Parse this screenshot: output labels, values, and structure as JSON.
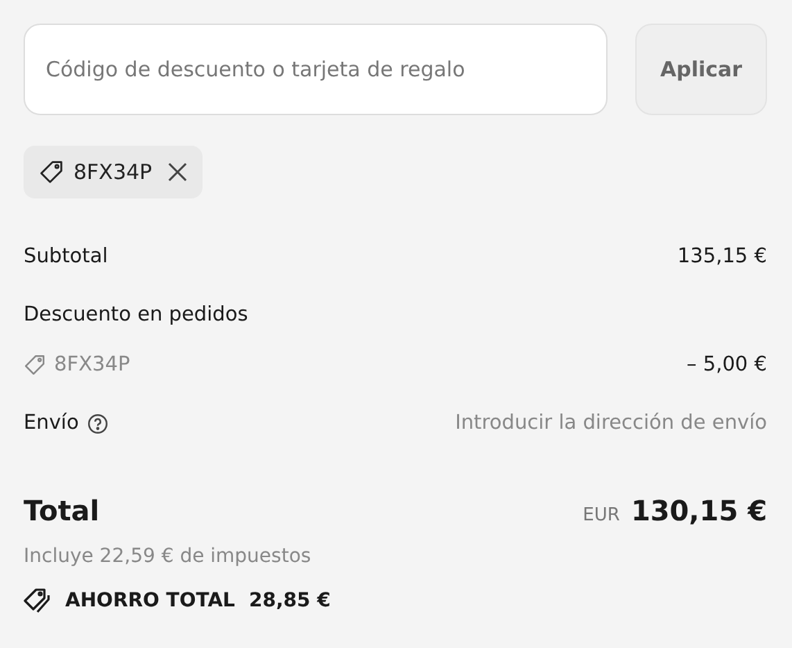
{
  "discount_field": {
    "placeholder": "Código de descuento o tarjeta de regalo"
  },
  "apply_button": {
    "label": "Aplicar"
  },
  "applied_codes": [
    {
      "code": "8FX34P"
    }
  ],
  "subtotal": {
    "label": "Subtotal",
    "value": "135,15 €"
  },
  "order_discount": {
    "label": "Descuento en pedidos",
    "code": "8FX34P",
    "value": "– 5,00 €"
  },
  "shipping": {
    "label": "Envío",
    "value": "Introducir la dirección de envío"
  },
  "total": {
    "label": "Total",
    "currency": "EUR",
    "value": "130,15 €",
    "taxes": "Incluye 22,59 € de impuestos"
  },
  "savings": {
    "label": "AHORRO TOTAL",
    "value": "28,85 €"
  }
}
